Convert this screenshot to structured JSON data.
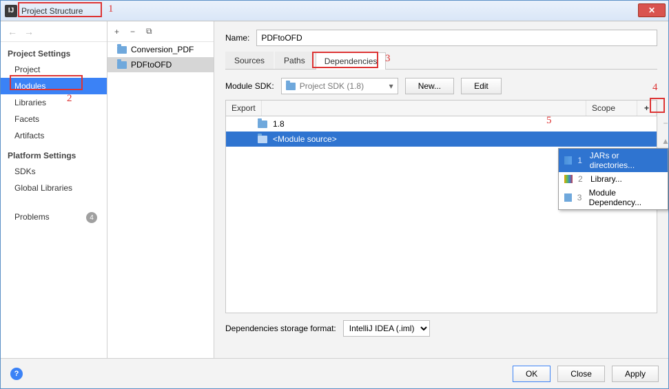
{
  "window": {
    "title": "Project Structure"
  },
  "nav": {
    "back_icon": "←",
    "fwd_icon": "→",
    "groups": [
      {
        "title": "Project Settings",
        "items": [
          {
            "label": "Project",
            "key": "project"
          },
          {
            "label": "Modules",
            "key": "modules",
            "selected": true
          },
          {
            "label": "Libraries",
            "key": "libraries"
          },
          {
            "label": "Facets",
            "key": "facets"
          },
          {
            "label": "Artifacts",
            "key": "artifacts"
          }
        ]
      },
      {
        "title": "Platform Settings",
        "items": [
          {
            "label": "SDKs",
            "key": "sdks"
          },
          {
            "label": "Global Libraries",
            "key": "global-libraries"
          }
        ]
      }
    ],
    "problems": {
      "label": "Problems",
      "count": "4"
    }
  },
  "modules": {
    "toolbar": {
      "add": "+",
      "remove": "−",
      "copy": "⧉"
    },
    "list": [
      {
        "label": "Conversion_PDF"
      },
      {
        "label": "PDFtoOFD",
        "selected": true
      }
    ]
  },
  "main": {
    "name_label": "Name:",
    "name_value": "PDFtoOFD",
    "tabs": [
      {
        "label": "Sources",
        "key": "sources"
      },
      {
        "label": "Paths",
        "key": "paths"
      },
      {
        "label": "Dependencies",
        "key": "dependencies",
        "active": true
      }
    ],
    "sdk": {
      "label": "Module SDK:",
      "value": "Project SDK (1.8)",
      "new_btn": "New...",
      "edit_btn": "Edit"
    },
    "table": {
      "headers": {
        "export": "Export",
        "scope": "Scope",
        "plus": "+"
      },
      "rows": [
        {
          "label": "1.8",
          "icon": "folder"
        },
        {
          "label": "<Module source>",
          "icon": "folder",
          "selected": true
        }
      ]
    },
    "side_actions": {
      "remove": "−",
      "up": "▲",
      "down": "▼",
      "edit": "✎"
    },
    "storage": {
      "label": "Dependencies storage format:",
      "value": "IntelliJ IDEA (.iml)"
    }
  },
  "popup": {
    "items": [
      {
        "idx": "1",
        "label": "JARs or directories...",
        "icon": "jar",
        "selected": true
      },
      {
        "idx": "2",
        "label": "Library...",
        "icon": "lib"
      },
      {
        "idx": "3",
        "label": "Module Dependency...",
        "icon": "mod"
      }
    ]
  },
  "footer": {
    "ok": "OK",
    "close": "Close",
    "apply": "Apply"
  },
  "annotations": {
    "n1": "1",
    "n2": "2",
    "n3": "3",
    "n4": "4",
    "n5": "5"
  }
}
